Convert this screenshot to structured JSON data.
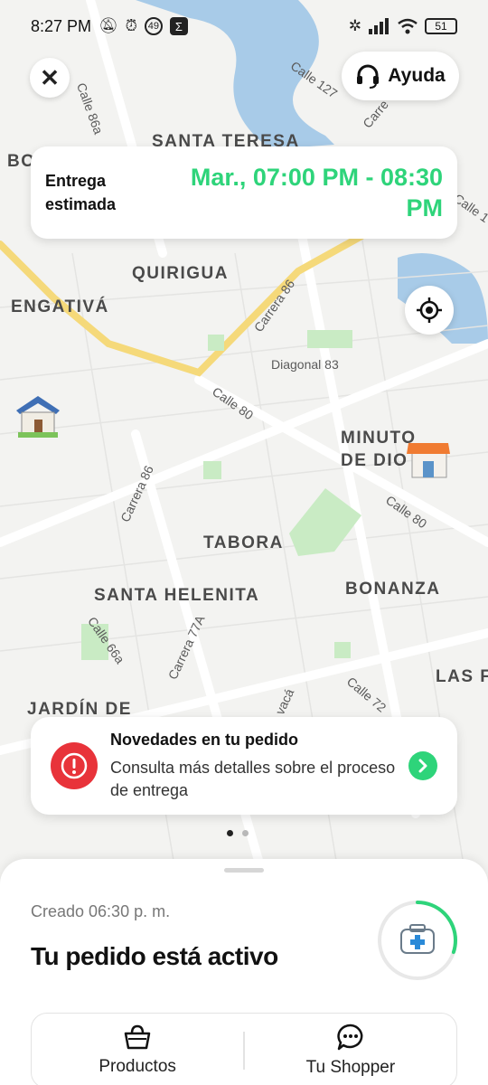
{
  "status_bar": {
    "time": "8:27 PM",
    "icons": [
      "mute-icon",
      "alarm-icon",
      "badge-49-icon",
      "app-icon"
    ],
    "badge_number": "49",
    "battery": "51"
  },
  "header": {
    "close_icon": "close-icon",
    "help_label": "Ayuda",
    "help_icon": "headset-icon"
  },
  "eta": {
    "label": "Entrega estimada",
    "value": "Mar., 07:00 PM - 08:30 PM",
    "color": "#2ed47a"
  },
  "map": {
    "districts": [
      "SANTA TERESA",
      "BO",
      "QUIRIGUA",
      "ENGATIVÁ",
      "MINUTO",
      "DE DIO",
      "TABORA",
      "SANTA HELENITA",
      "BONANZA",
      "LAS F",
      "JARDÍN DE"
    ],
    "streets": [
      "Calle 127",
      "Calle 86a",
      "Carre",
      "Calle 1",
      "Carrera 86",
      "Diagonal 83",
      "Calle 80",
      "Calle 80",
      "Carrera 86",
      "Calle 66a",
      "Carrera 77A",
      "vacá",
      "Calle 72"
    ],
    "markers": [
      "home-marker-icon",
      "store-marker-icon"
    ]
  },
  "locate_icon": "crosshair-icon",
  "news": {
    "title": "Novedades en tu pedido",
    "body": "Consulta más detalles sobre el proceso de entrega",
    "alert_color": "#e8333a"
  },
  "pager": {
    "count": 2,
    "active": 0
  },
  "order": {
    "created": "Creado 06:30 p. m.",
    "title": "Tu pedido está activo",
    "progress_fraction": 0.3,
    "progress_icon": "medical-kit-icon",
    "tabs": [
      {
        "label": "Productos",
        "icon": "basket-icon"
      },
      {
        "label": "Tu Shopper",
        "icon": "chat-icon"
      }
    ]
  }
}
